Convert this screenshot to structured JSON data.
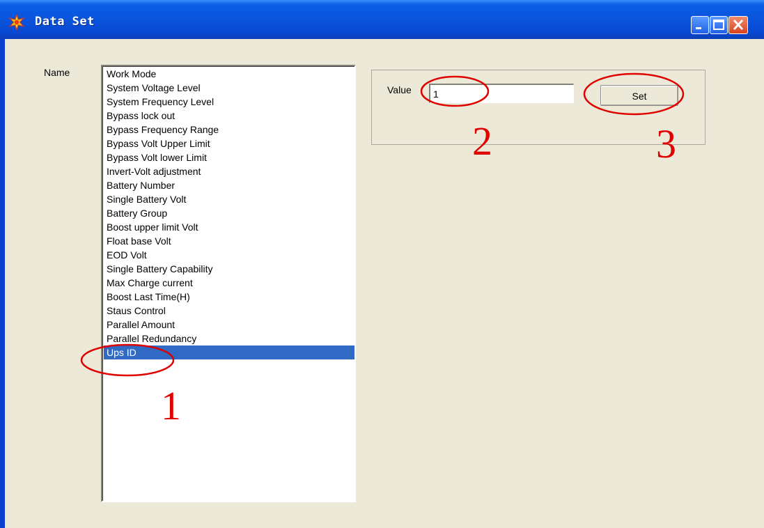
{
  "window": {
    "title": "Data Set",
    "icon": "app-star-icon",
    "controls": [
      "minimize-icon",
      "maximize-icon",
      "close-icon"
    ]
  },
  "form": {
    "name_label": "Name",
    "value_label": "Value",
    "value": "1",
    "set_label": "Set"
  },
  "list": {
    "items": [
      "Work Mode",
      "System Voltage Level",
      "System Frequency Level",
      "Bypass lock out",
      "Bypass Frequency Range",
      "Bypass Volt Upper Limit",
      "Bypass Volt lower Limit",
      "Invert-Volt adjustment",
      "Battery Number",
      "Single Battery Volt",
      "Battery Group",
      "Boost upper limit Volt",
      "Float base Volt",
      "EOD Volt",
      "Single Battery Capability",
      "Max Charge current",
      "Boost Last Time(H)",
      "Staus Control",
      "Parallel Amount",
      "Parallel Redundancy",
      "Ups ID"
    ],
    "selected_index": 20
  },
  "annotations": {
    "label_1": "1",
    "label_2": "2",
    "label_3": "3",
    "color": "#e00000"
  },
  "colors": {
    "titlebar": "#0a55de",
    "client": "#ece9d8",
    "selection": "#316ac5"
  }
}
